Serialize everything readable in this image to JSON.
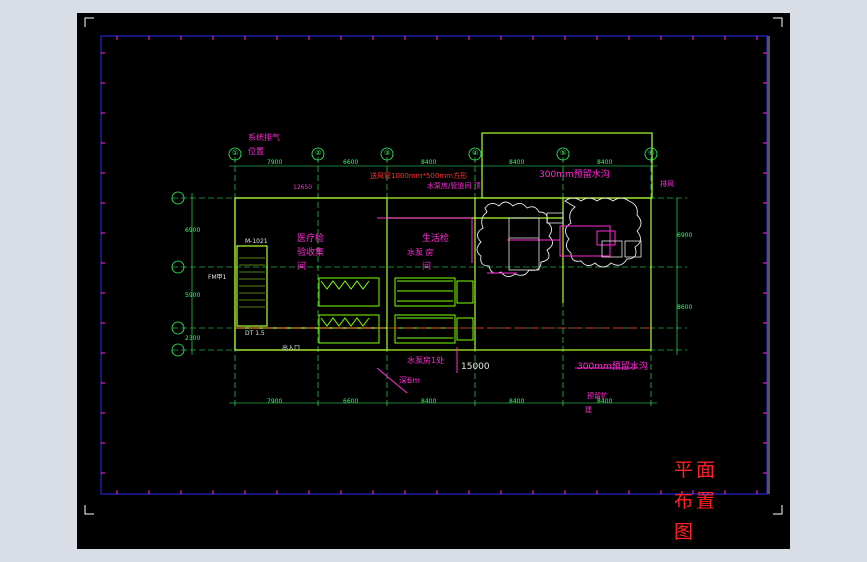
{
  "colors": {
    "background": "#000000",
    "border": "#2a2aff",
    "axis": "#33ff66",
    "wall": "#b0ff30",
    "annotation": "#ff2bd6",
    "title": "#ff2020",
    "equipment": "#7dff00"
  },
  "drawing": {
    "title_chars": [
      "平",
      "面",
      "布",
      "置",
      "图"
    ],
    "axis_labels": [
      "①",
      "②",
      "③",
      "④",
      "⑤",
      "⑥"
    ],
    "top_dims": [
      "7900",
      "6600",
      "8400",
      "8400",
      "8400"
    ],
    "bottom_dims": [
      "7900",
      "6600",
      "8400",
      "8400",
      "8400"
    ],
    "left_dims": [
      "6900",
      "5900",
      "2300"
    ],
    "right_dims": [
      "6900",
      "8600"
    ],
    "span_dim": "12650",
    "total_dim": "15000",
    "notes": {
      "exhaust_1": "系统排气",
      "exhaust_2": "位置",
      "duct": "送风管1000mm*500mm方形",
      "duct_2": "水泵房/管道间 顶",
      "reserve": "300mm预留水沟",
      "reserve_2": "300mm预留水沟",
      "room_1": "医疗检",
      "room_2": "验收集",
      "room_3": "间",
      "room_4": "生活检",
      "room_5": "水泵",
      "room_6": "间",
      "room_7": "房",
      "pump": "水泵 房",
      "pit": "水泵房1处",
      "depth": "深6m",
      "expand": "预留扩",
      "expand_2": "建",
      "exhaust_right": "排风",
      "stair": "楼梯",
      "fm": "FM甲1",
      "dt": "DT 1.5",
      "wm": "M-1021",
      "out": "出入口"
    }
  }
}
